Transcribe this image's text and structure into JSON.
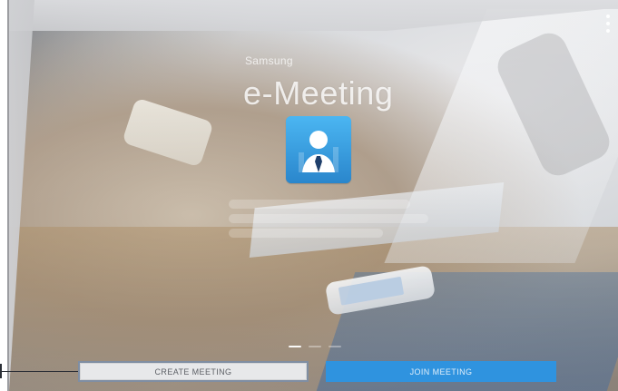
{
  "app": {
    "brand_small": "Samsung",
    "brand_title": "e-Meeting"
  },
  "actions": {
    "create_meeting": "CREATE MEETING",
    "join_meeting": "JOIN MEETING"
  },
  "pager": {
    "active_index": 0,
    "count": 3
  },
  "colors": {
    "primary_button": "#2f93df",
    "secondary_button": "#e7e8ea",
    "highlight_border": "#7f8ea3",
    "icon_bg": "#2a86cc"
  },
  "icons": {
    "app_icon": "user-with-tie-icon",
    "overflow_menu": "more-vert-icon"
  }
}
